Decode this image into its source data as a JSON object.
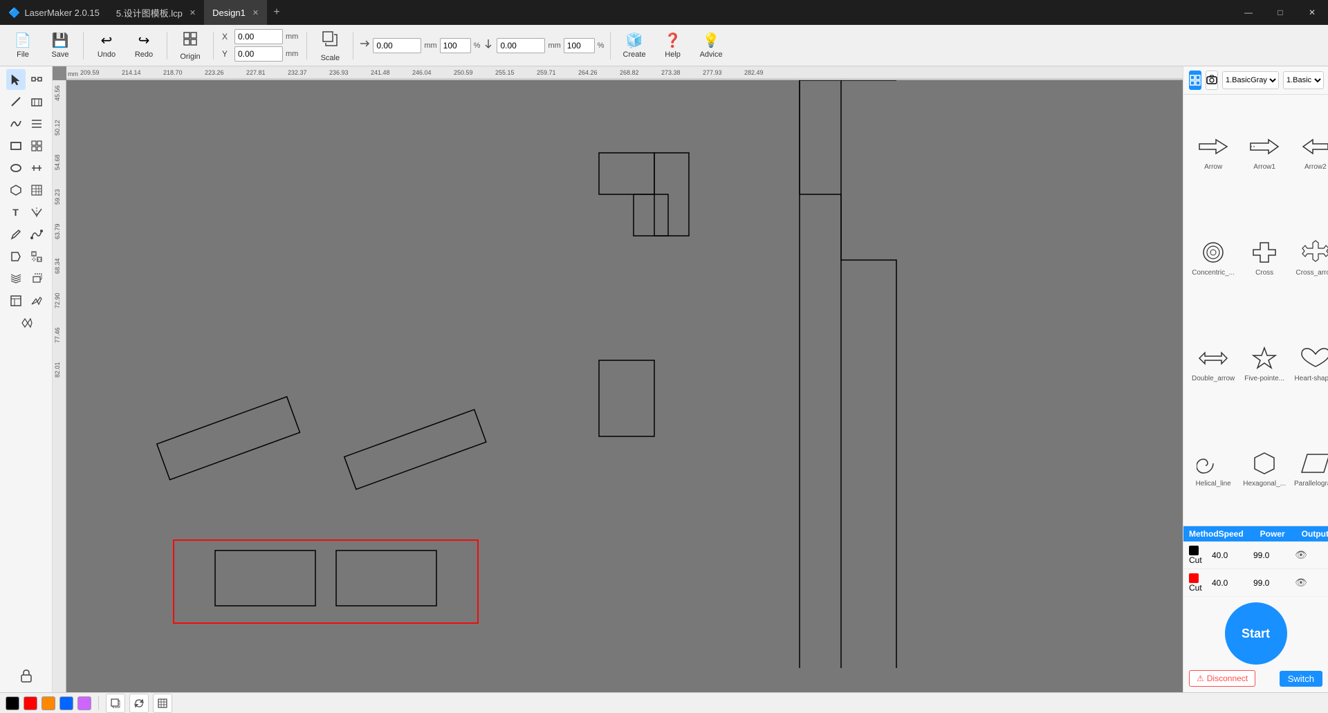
{
  "titlebar": {
    "tabs": [
      {
        "id": "app",
        "label": "LaserMaker 2.0.15",
        "icon": "🔷",
        "closable": false,
        "active": false
      },
      {
        "id": "file1",
        "label": "5.设计图模板.lcp",
        "icon": "",
        "closable": true,
        "active": false
      },
      {
        "id": "design1",
        "label": "Design1",
        "icon": "",
        "closable": true,
        "active": true
      }
    ],
    "add_tab_label": "+",
    "controls": [
      "—",
      "□",
      "✕"
    ]
  },
  "toolbar": {
    "buttons": [
      {
        "id": "file",
        "icon": "📄",
        "label": "File"
      },
      {
        "id": "save",
        "icon": "💾",
        "label": "Save"
      },
      {
        "id": "undo",
        "icon": "↩",
        "label": "Undo"
      },
      {
        "id": "redo",
        "icon": "↪",
        "label": "Redo"
      },
      {
        "id": "origin",
        "icon": "⊞",
        "label": "Origin"
      },
      {
        "id": "scale",
        "icon": "⇲",
        "label": "Scale"
      },
      {
        "id": "create",
        "icon": "🧊",
        "label": "Create"
      },
      {
        "id": "help",
        "icon": "❓",
        "label": "Help"
      },
      {
        "id": "advice",
        "icon": "💡",
        "label": "Advice"
      }
    ],
    "x_label": "X",
    "y_label": "Y",
    "x_value": "0.00",
    "y_value": "0.00",
    "w_value": "0.00",
    "h_value": "0.00",
    "w_percent": "100",
    "h_percent": "100",
    "mm_label": "mm"
  },
  "left_tools": [
    {
      "id": "select",
      "icon": "↖",
      "active": true
    },
    {
      "id": "node",
      "icon": "⬡",
      "active": false
    },
    {
      "id": "line",
      "icon": "╱",
      "active": false
    },
    {
      "id": "curve",
      "icon": "∿",
      "active": false
    },
    {
      "id": "rect",
      "icon": "▭",
      "active": false
    },
    {
      "id": "ellipse",
      "icon": "⬭",
      "active": false
    },
    {
      "id": "polygon",
      "icon": "⬡",
      "active": false
    },
    {
      "id": "text",
      "icon": "T",
      "active": false
    },
    {
      "id": "pencil",
      "icon": "✏",
      "active": false
    },
    {
      "id": "erase",
      "icon": "◇",
      "active": false
    },
    {
      "id": "fill",
      "icon": "🪣",
      "active": false
    },
    {
      "id": "grid2",
      "icon": "⊞",
      "active": false
    },
    {
      "id": "layers",
      "icon": "⧉",
      "active": false
    },
    {
      "id": "table",
      "icon": "▦",
      "active": false
    },
    {
      "id": "misc",
      "icon": "✦",
      "active": false
    }
  ],
  "right_panel": {
    "view_buttons": [
      {
        "id": "grid-view",
        "icon": "⊞",
        "active": false
      },
      {
        "id": "camera-view",
        "icon": "📷",
        "active": false
      }
    ],
    "lib_options": [
      "1.BasicGray",
      "1.Basic"
    ],
    "lib_selected": "1.BasicGray",
    "lib_selected2": "1.Basic",
    "shapes": [
      {
        "id": "arrow",
        "label": "Arrow"
      },
      {
        "id": "arrow1",
        "label": "Arrow1"
      },
      {
        "id": "arrow2",
        "label": "Arrow2"
      },
      {
        "id": "concentric",
        "label": "Concentric_..."
      },
      {
        "id": "cross",
        "label": "Cross"
      },
      {
        "id": "cross_arrow",
        "label": "Cross_arrow"
      },
      {
        "id": "double_arrow",
        "label": "Double_arrow"
      },
      {
        "id": "five_pointed",
        "label": "Five-pointe..."
      },
      {
        "id": "heart",
        "label": "Heart-shaped"
      },
      {
        "id": "helical",
        "label": "Helical_line"
      },
      {
        "id": "hexagonal",
        "label": "Hexagonal_..."
      },
      {
        "id": "parallelogram",
        "label": "Parallelogram"
      }
    ],
    "layers": {
      "header": [
        "Method",
        "Speed",
        "Power",
        "Output"
      ],
      "rows": [
        {
          "color": "#000000",
          "method": "Cut",
          "speed": "40.0",
          "power": "99.0",
          "visible": true
        },
        {
          "color": "#ff0000",
          "method": "Cut",
          "speed": "40.0",
          "power": "99.0",
          "visible": true
        }
      ]
    },
    "start_button": "Start",
    "disconnect_label": "Disconnect",
    "switch_label": "Switch"
  },
  "color_strip": {
    "colors": [
      "#000000",
      "#ff0000",
      "#ff8800",
      "#0066ff",
      "#cc66ff"
    ],
    "tools": [
      "⬚",
      "⟳⟳",
      "↺↻",
      "⊞"
    ]
  },
  "canvas": {
    "ruler_marks_h": [
      "209.59",
      "214.14",
      "218.70",
      "223.26",
      "227.81",
      "232.37",
      "236.93",
      "241.48",
      "246.04",
      "250.59",
      "255.15",
      "259.71",
      "264.26",
      "268.82",
      "273.38",
      "277.93",
      "282.49"
    ],
    "ruler_marks_v": [
      "45.56",
      "50.12",
      "54.68",
      "59.23",
      "63.79",
      "68.34",
      "72.90",
      "77.46",
      "82.01"
    ]
  }
}
